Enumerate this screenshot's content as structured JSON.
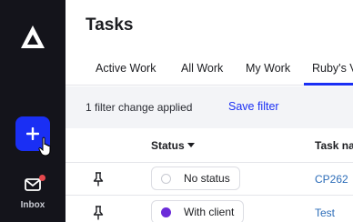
{
  "sidebar": {
    "add_label": "+",
    "inbox_label": "Inbox"
  },
  "header": {
    "title": "Tasks"
  },
  "tabs": [
    {
      "label": "Active Work"
    },
    {
      "label": "All Work"
    },
    {
      "label": "My Work"
    },
    {
      "label": "Ruby's V"
    }
  ],
  "filterbar": {
    "message": "1 filter change applied",
    "save_label": "Save filter"
  },
  "table": {
    "columns": [
      "Status",
      "Task nam"
    ],
    "rows": [
      {
        "status": "No status",
        "status_color": "#ffffff",
        "task": "CP262"
      },
      {
        "status": "With client",
        "status_color": "#6b2bd9",
        "task": "Test"
      }
    ]
  },
  "colors": {
    "accent": "#1a2ff4",
    "sidebar_bg": "#14141b",
    "notification": "#e5484d"
  }
}
